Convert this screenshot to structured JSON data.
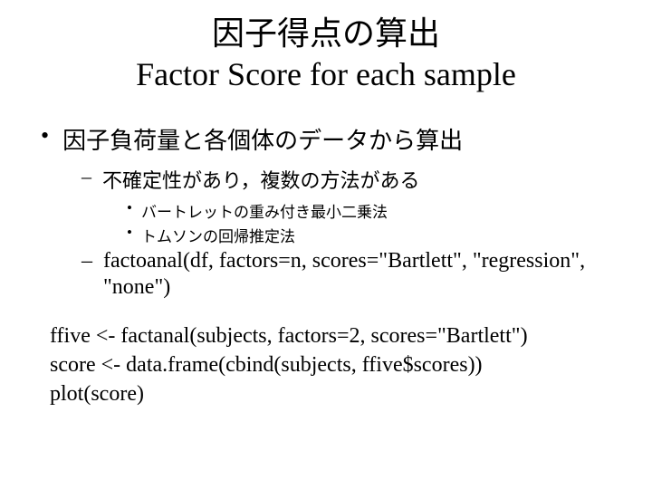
{
  "title_line1": "因子得点の算出",
  "title_line2": "Factor Score for each sample",
  "l1_1": "因子負荷量と各個体のデータから算出",
  "l2_1": "不確定性があり，複数の方法がある",
  "l3_1": "バートレットの重み付き最小二乗法",
  "l3_2": "トムソンの回帰推定法",
  "l2_2": "factoanal(df, factors=n, scores=\"Bartlett\", \"regression\", \"none\")",
  "code_1": "ffive <-  factanal(subjects, factors=2, scores=\"Bartlett\")",
  "code_2": "score <- data.frame(cbind(subjects, ffive$scores))",
  "code_3": "plot(score)"
}
